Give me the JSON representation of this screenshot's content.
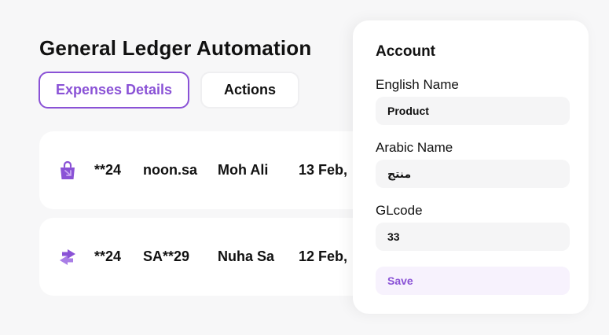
{
  "header": {
    "title": "General Ledger Automation"
  },
  "tabs": [
    {
      "label": "Expenses Details",
      "active": true
    },
    {
      "label": "Actions",
      "active": false
    }
  ],
  "transactions": [
    {
      "icon": "shopping-bag-icon",
      "card": "**24",
      "merchant": "noon.sa",
      "user": "Moh Ali",
      "date": "13 Feb,"
    },
    {
      "icon": "transfer-arrows-icon",
      "card": "**24",
      "merchant": "SA**29",
      "user": "Nuha Sa",
      "date": "12 Feb,"
    }
  ],
  "account_panel": {
    "title": "Account",
    "english_name": {
      "label": "English Name",
      "value": "Product"
    },
    "arabic_name": {
      "label": "Arabic Name",
      "value": "منتج"
    },
    "glcode": {
      "label": "GLcode",
      "value": "33"
    },
    "save_label": "Save"
  },
  "colors": {
    "accent": "#8a52d6",
    "background": "#f7f7f8",
    "card": "#ffffff",
    "input_bg": "#f5f5f6"
  }
}
